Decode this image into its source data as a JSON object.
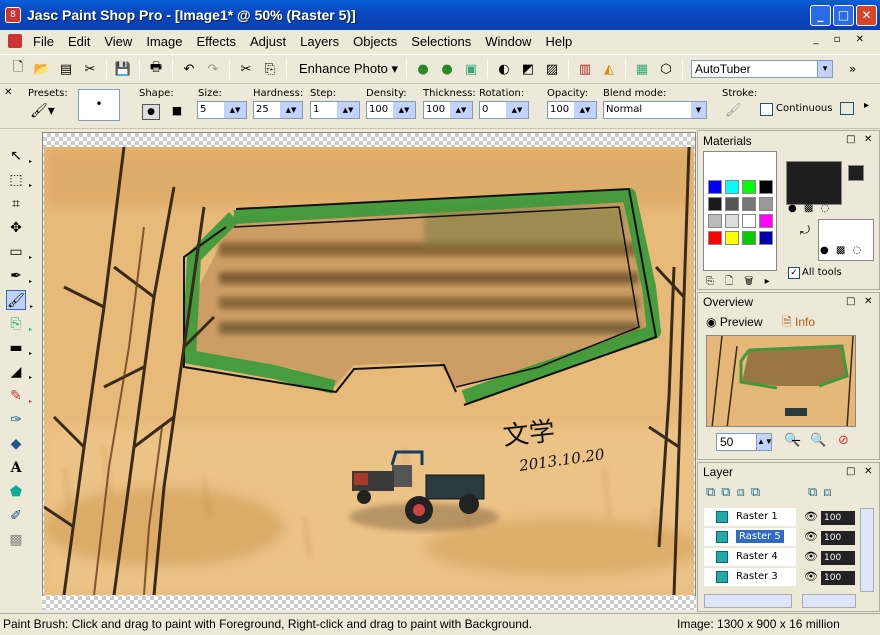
{
  "window": {
    "app_name": "Jasc Paint Shop Pro",
    "title": "Jasc Paint Shop Pro - [Image1* @  50% (Raster 5)]",
    "minimize": "_",
    "maximize": "□",
    "close": "✕"
  },
  "menu": {
    "items": [
      "File",
      "Edit",
      "View",
      "Image",
      "Effects",
      "Adjust",
      "Layers",
      "Objects",
      "Selections",
      "Window",
      "Help"
    ]
  },
  "toolbar": {
    "enhance_photo": "Enhance Photo",
    "script_select": "AutoTuber"
  },
  "tool_options": {
    "presets_label": "Presets:",
    "shape_label": "Shape:",
    "size_label": "Size:",
    "size_value": "5",
    "hardness_label": "Hardness:",
    "hardness_value": "25",
    "step_label": "Step:",
    "step_value": "1",
    "density_label": "Density:",
    "density_value": "100",
    "thickness_label": "Thickness:",
    "thickness_value": "100",
    "rotation_label": "Rotation:",
    "rotation_value": "0",
    "opacity_label": "Opacity:",
    "opacity_value": "100",
    "blend_mode_label": "Blend mode:",
    "blend_mode_value": "Normal",
    "stroke_label": "Stroke:",
    "continuous_label": "Continuous"
  },
  "materials": {
    "title": "Materials",
    "all_tools_label": "All tools",
    "palette_colors": [
      "#0000ff",
      "#00ffff",
      "#00ff00",
      "#000000",
      "#1a1a1a",
      "#555555",
      "#777777",
      "#999999",
      "#bbbbbb",
      "#dddddd",
      "#ffffff",
      "#ff00ff",
      "#ff0000",
      "#ffff00",
      "#00cc00",
      "#0000aa"
    ]
  },
  "overview": {
    "title": "Overview",
    "tab_preview": "Preview",
    "tab_info": "Info",
    "zoom_value": "50"
  },
  "layers": {
    "title": "Layer",
    "rows": [
      {
        "name": "Raster 1",
        "opacity": "100",
        "selected": false
      },
      {
        "name": "Raster 5",
        "opacity": "100",
        "selected": true
      },
      {
        "name": "Raster 4",
        "opacity": "100",
        "selected": false
      },
      {
        "name": "Raster 3",
        "opacity": "100",
        "selected": false
      }
    ]
  },
  "canvas": {
    "signature_name": "文学",
    "signature_date": "2013.10.20"
  },
  "status": {
    "hint": "Paint Brush: Click and drag to paint with Foreground, Right-click and drag to paint with Background.",
    "image_info": "Image:  1300 x 900 x 16 million"
  }
}
